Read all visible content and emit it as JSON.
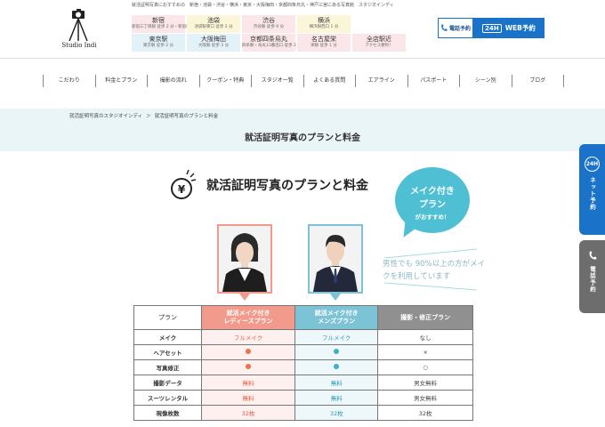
{
  "header": {
    "tagline": "就活証明写真におすすめの　新宿・池袋・渋谷・横浜・東京・大阪梅田・京都四条烏丸・神戸三宮にある写真館　スタジオインディ",
    "logo_text": "Studio Indi",
    "stations": [
      {
        "name": "新宿",
        "sub": "新宿三丁目駅 徒歩 2 分・新宿駅徒歩 9 分",
        "color": "pink"
      },
      {
        "name": "池袋",
        "sub": "池袋駅東口 徒歩 2 分",
        "color": "yellow"
      },
      {
        "name": "渋谷",
        "sub": "渋谷駅 徒歩 9 分",
        "color": "pink"
      },
      {
        "name": "横浜",
        "sub": "横浜駅西口 1 分",
        "color": "yellow"
      },
      {
        "name": "東京駅",
        "sub": "東京駅 徒歩 2 分",
        "color": "blue"
      },
      {
        "name": "大阪梅田",
        "sub": "大阪駅 徒歩 3 分",
        "color": "blue"
      },
      {
        "name": "京都四条烏丸",
        "sub": "四条駅・烏丸13番出口 徒歩 2 分",
        "color": "pink"
      },
      {
        "name": "名古屋栄",
        "sub": "栄駅 徒歩 1 分",
        "color": "pink"
      },
      {
        "name": "全店駅近",
        "sub": "アクセス便利！",
        "color": "pink"
      }
    ],
    "tel_button": "電話予約",
    "web_badge": "24H",
    "web_button": "WEB予約"
  },
  "nav": [
    "こだわり",
    "料金とプラン",
    "撮影の流れ",
    "クーポン・特典",
    "スタジオ一覧",
    "よくある質問",
    "エアライン",
    "パスポート",
    "シーン別",
    "ブログ"
  ],
  "breadcrumb": [
    "就活証明写真のスタジオインディ",
    "＞",
    "就活証明写真のプランと料金"
  ],
  "page_title": "就活証明写真のプランと料金",
  "section_title": "就活証明写真のプランと料金",
  "bubble": {
    "line1": "メイク付き",
    "line2": "プラン",
    "line3": "がおすすめ！"
  },
  "sub_note": "男性でも 90%以上の方がメイクを利用しています",
  "table": {
    "headers": [
      "プラン",
      "就活メイク付き\nレディースプラン",
      "就活メイク付き\nメンズプラン",
      "撮影・修正プラン"
    ],
    "rows": [
      {
        "label": "メイク",
        "ladies": "フルメイク",
        "mens": "フルメイク",
        "other": "なし"
      },
      {
        "label": "ヘアセット",
        "ladies": "●",
        "mens": "●",
        "other": "×"
      },
      {
        "label": "写真修正",
        "ladies": "●",
        "mens": "●",
        "other": "○"
      },
      {
        "label": "撮影データ",
        "ladies": "無料",
        "mens": "無料",
        "other": "男女無料"
      },
      {
        "label": "スーツレンタル",
        "ladies": "無料",
        "mens": "無料",
        "other": "男女無料"
      },
      {
        "label": "現像枚数",
        "ladies": "32枚",
        "mens": "32枚",
        "other": "32枚"
      }
    ]
  },
  "side_tabs": {
    "net_badge": "24H",
    "net_label": "ネット予約",
    "tel_label": "電話予約"
  },
  "colors": {
    "brand_blue": "#1a73c8",
    "ladies_pink": "#f29a8c",
    "mens_blue": "#7dc3d6",
    "bubble": "#4fc0d4"
  }
}
